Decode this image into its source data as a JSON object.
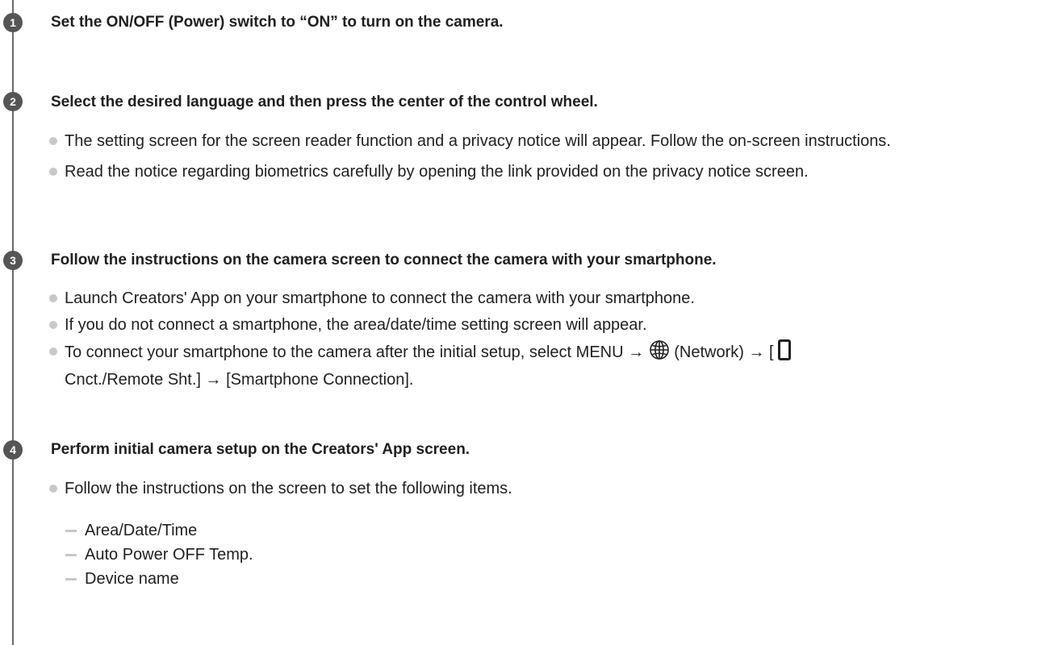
{
  "steps": [
    {
      "number": "1",
      "title": "Set the ON/OFF (Power) switch to “ON” to turn on the camera."
    },
    {
      "number": "2",
      "title": "Select the desired language and then press the center of the control wheel.",
      "bullets": [
        "The setting screen for the screen reader function and a privacy notice will appear. Follow the on-screen instructions.",
        "Read the notice regarding biometrics carefully by opening the link provided on the privacy notice screen."
      ]
    },
    {
      "number": "3",
      "title": "Follow the instructions on the camera screen to connect the camera with your smartphone.",
      "bullets": [
        "Launch Creators' App on your smartphone to connect the camera with your smartphone.",
        "If you do not connect a smartphone, the area/date/time setting screen will appear."
      ],
      "bullet3": {
        "part1": "To connect your smartphone to the camera after the initial setup, select MENU → ",
        "part2": " (Network) → [",
        "part3": "Cnct./Remote Sht.] → [Smartphone Connection].",
        "network_icon": "globe-icon",
        "phone_icon": "smartphone-icon"
      }
    },
    {
      "number": "4",
      "title": "Perform initial camera setup on the Creators' App screen.",
      "bullets": [
        "Follow the instructions on the screen to set the following items."
      ],
      "subitems": [
        "Area/Date/Time",
        "Auto Power OFF Temp.",
        "Device name"
      ]
    }
  ]
}
